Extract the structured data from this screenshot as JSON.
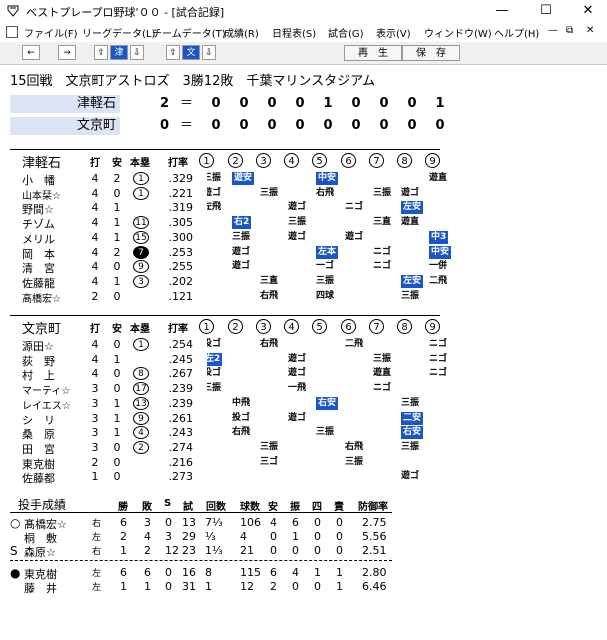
{
  "window": {
    "title": "ベストプレープロ野球'００ - [試合記録]",
    "controls": [
      "minimize",
      "maximize",
      "close"
    ]
  },
  "menu": [
    "ファイル(F)",
    "リーグデータ(L)",
    "チームデータ(T)",
    "成績(R)",
    "日程表(S)",
    "試合(G)",
    "表示(V)",
    "ウィンドウ(W)",
    "ヘルプ(H)"
  ],
  "toolbar": {
    "left_arrow": "←",
    "right_arrow": "→",
    "up1": "⇧",
    "team1": "津",
    "down1": "⇩",
    "up2": "⇧",
    "team2": "文",
    "down2": "⇩",
    "replay_label": "再　生",
    "save_label": "保　存"
  },
  "game": {
    "title": "15回戦　文京町アストロズ　3勝12敗　千葉マリンスタジアム"
  },
  "scoreboard": {
    "teams": [
      {
        "name": "津軽石",
        "total": "2",
        "innings": [
          "0",
          "0",
          "0",
          "0",
          "1",
          "0",
          "0",
          "0",
          "1"
        ]
      },
      {
        "name": "文京町",
        "total": "0",
        "innings": [
          "0",
          "0",
          "0",
          "0",
          "0",
          "0",
          "0",
          "0",
          "0"
        ]
      }
    ],
    "eq": "＝"
  },
  "batting_headers": {
    "ab": "打",
    "hits": "安",
    "hr": "本塁",
    "avg": "打率",
    "innings": [
      "1",
      "2",
      "3",
      "4",
      "5",
      "6",
      "7",
      "8",
      "9"
    ]
  },
  "batting": [
    {
      "team": "津軽石",
      "players": [
        {
          "name": "小　幡",
          "ab": "4",
          "h": "2",
          "hr": "1",
          "hr_fill": false,
          "avg": ".329",
          "res": [
            [
              "三振",
              ""
            ],
            [
              "遊安",
              "hit"
            ],
            [
              "中安",
              "hit"
            ],
            [
              "",
              ""
            ],
            [
              "遊直",
              ""
            ]
          ],
          "slots": [
            0,
            1,
            2,
            3,
            4
          ]
        },
        {
          "name": "山本栞☆",
          "ab": "4",
          "h": "0",
          "hr": "1",
          "hr_fill": false,
          "avg": ".221",
          "res": [
            [
              "遊ゴ",
              ""
            ],
            [
              "三振",
              ""
            ],
            [
              "右飛",
              ""
            ],
            [
              "三振",
              ""
            ],
            [
              "遊ゴ",
              ""
            ]
          ]
        },
        {
          "name": "野間☆",
          "ab": "4",
          "h": "1",
          "hr": "",
          "hr_fill": false,
          "avg": ".319",
          "res": [
            [
              "左飛",
              ""
            ],
            [
              "遊ゴ",
              ""
            ],
            [
              "ニゴ",
              ""
            ],
            [
              "左安",
              "hit"
            ]
          ]
        },
        {
          "name": "チゾム",
          "ab": "4",
          "h": "1",
          "hr": "11",
          "hr_fill": false,
          "avg": ".305",
          "res": [
            [
              "右2",
              "hit"
            ],
            [
              "三振",
              ""
            ],
            [
              "三直",
              ""
            ],
            [
              "遊直",
              ""
            ]
          ]
        },
        {
          "name": "メリル",
          "ab": "4",
          "h": "1",
          "hr": "15",
          "hr_fill": false,
          "avg": ".300",
          "res": [
            [
              "三振",
              ""
            ],
            [
              "遊ゴ",
              ""
            ],
            [
              "遊ゴ",
              ""
            ],
            [
              "中3",
              "hit"
            ]
          ]
        },
        {
          "name": "岡　本",
          "ab": "4",
          "h": "2",
          "hr": "7",
          "hr_fill": true,
          "avg": ".253",
          "res": [
            [
              "遊ゴ",
              ""
            ],
            [
              "左本",
              "hit"
            ],
            [
              "ニゴ",
              ""
            ],
            [
              "中安",
              "hit"
            ]
          ]
        },
        {
          "name": "清　宮",
          "ab": "4",
          "h": "0",
          "hr": "9",
          "hr_fill": false,
          "avg": ".255",
          "res": [
            [
              "遊ゴ",
              ""
            ],
            [
              "一ゴ",
              ""
            ],
            [
              "ニゴ",
              ""
            ],
            [
              "一併",
              ""
            ]
          ]
        },
        {
          "name": "佐藤龍",
          "ab": "4",
          "h": "1",
          "hr": "3",
          "hr_fill": false,
          "avg": ".202",
          "res": [
            [
              "三直",
              ""
            ],
            [
              "三振",
              ""
            ],
            [
              "左安",
              "hit"
            ],
            [
              "二飛",
              ""
            ]
          ]
        },
        {
          "name": "髙橋宏☆",
          "ab": "2",
          "h": "0",
          "hr": "",
          "hr_fill": false,
          "avg": ".121",
          "res": [
            [
              "右飛",
              ""
            ],
            [
              "四球",
              ""
            ],
            [
              "三振",
              ""
            ]
          ]
        }
      ]
    },
    {
      "team": "文京町",
      "players": [
        {
          "name": "源田☆",
          "ab": "4",
          "h": "0",
          "hr": "1",
          "hr_fill": false,
          "avg": ".254",
          "res": [
            [
              "投ゴ",
              ""
            ],
            [
              "右飛",
              ""
            ],
            [
              "二飛",
              ""
            ],
            [
              "ニゴ",
              ""
            ]
          ]
        },
        {
          "name": "荻　野",
          "ab": "4",
          "h": "1",
          "hr": "",
          "hr_fill": false,
          "avg": ".245",
          "res": [
            [
              "左2",
              "hit"
            ],
            [
              "遊ゴ",
              ""
            ],
            [
              "三振",
              ""
            ],
            [
              "ニゴ",
              ""
            ]
          ]
        },
        {
          "name": "村　上",
          "ab": "4",
          "h": "0",
          "hr": "8",
          "hr_fill": false,
          "avg": ".267",
          "res": [
            [
              "投ゴ",
              ""
            ],
            [
              "遊ゴ",
              ""
            ],
            [
              "遊直",
              ""
            ],
            [
              "ニゴ",
              ""
            ]
          ]
        },
        {
          "name": "マーティ☆",
          "ab": "3",
          "h": "0",
          "hr": "17",
          "hr_fill": false,
          "avg": ".239",
          "res": [
            [
              "三振",
              ""
            ],
            [
              "一飛",
              ""
            ],
            [
              "ニゴ",
              ""
            ]
          ]
        },
        {
          "name": "レイエス☆",
          "ab": "3",
          "h": "1",
          "hr": "13",
          "hr_fill": false,
          "avg": ".239",
          "res": [
            [
              "中飛",
              ""
            ],
            [
              "右安",
              "hit"
            ],
            [
              "三振",
              ""
            ]
          ]
        },
        {
          "name": "シ　リ",
          "ab": "3",
          "h": "1",
          "hr": "9",
          "hr_fill": false,
          "avg": ".261",
          "res": [
            [
              "投ゴ",
              ""
            ],
            [
              "遊ゴ",
              ""
            ],
            [
              "二安",
              "hit"
            ]
          ]
        },
        {
          "name": "桑　原",
          "ab": "3",
          "h": "1",
          "hr": "4",
          "hr_fill": false,
          "avg": ".243",
          "res": [
            [
              "右飛",
              ""
            ],
            [
              "三振",
              ""
            ],
            [
              "右安",
              "hit"
            ]
          ]
        },
        {
          "name": "田　宮",
          "ab": "3",
          "h": "0",
          "hr": "2",
          "hr_fill": false,
          "avg": ".274",
          "res": [
            [
              "三振",
              ""
            ],
            [
              "右飛",
              ""
            ],
            [
              "三振",
              ""
            ]
          ]
        },
        {
          "name": "東克樹",
          "ab": "2",
          "h": "0",
          "hr": "",
          "hr_fill": false,
          "avg": ".216",
          "res": [
            [
              "三ゴ",
              ""
            ],
            [
              "三振",
              ""
            ]
          ]
        },
        {
          "name": "佐藤都",
          "ab": "1",
          "h": "0",
          "hr": "",
          "hr_fill": false,
          "avg": ".273",
          "res": [
            [
              "遊ゴ",
              ""
            ]
          ]
        }
      ]
    }
  ],
  "pitching": {
    "title": "投手成績",
    "headers": [
      "勝",
      "敗",
      "S",
      "試",
      "回数",
      "球数",
      "安",
      "振",
      "四",
      "責",
      "防御率"
    ],
    "teams": [
      {
        "pitchers": [
          {
            "mark": "○",
            "name": "髙橋宏☆",
            "hand": "右",
            "w": "6",
            "l": "3",
            "s": "0",
            "g": "13",
            "ip": "7⅓",
            "np": "106",
            "h": "4",
            "k": "6",
            "bb": "0",
            "er": "0",
            "era": "2.75"
          },
          {
            "mark": "",
            "name": "桐　敷",
            "hand": "左",
            "w": "2",
            "l": "4",
            "s": "3",
            "g": "29",
            "ip": "⅓",
            "np": "4",
            "h": "0",
            "k": "1",
            "bb": "0",
            "er": "0",
            "era": "5.56"
          },
          {
            "mark": "S",
            "name": "森原☆",
            "hand": "右",
            "w": "1",
            "l": "2",
            "s": "12",
            "g": "23",
            "ip": "1⅓",
            "np": "21",
            "h": "0",
            "k": "0",
            "bb": "0",
            "er": "0",
            "era": "2.51"
          }
        ]
      },
      {
        "pitchers": [
          {
            "mark": "●",
            "name": "東克樹",
            "hand": "左",
            "w": "6",
            "l": "6",
            "s": "0",
            "g": "16",
            "ip": "8",
            "np": "115",
            "h": "6",
            "k": "4",
            "bb": "1",
            "er": "1",
            "era": "2.80"
          },
          {
            "mark": "",
            "name": "藤　井",
            "hand": "左",
            "w": "1",
            "l": "1",
            "s": "0",
            "g": "31",
            "ip": "1",
            "np": "12",
            "h": "2",
            "k": "0",
            "bb": "0",
            "er": "1",
            "era": "6.46"
          }
        ]
      }
    ]
  }
}
